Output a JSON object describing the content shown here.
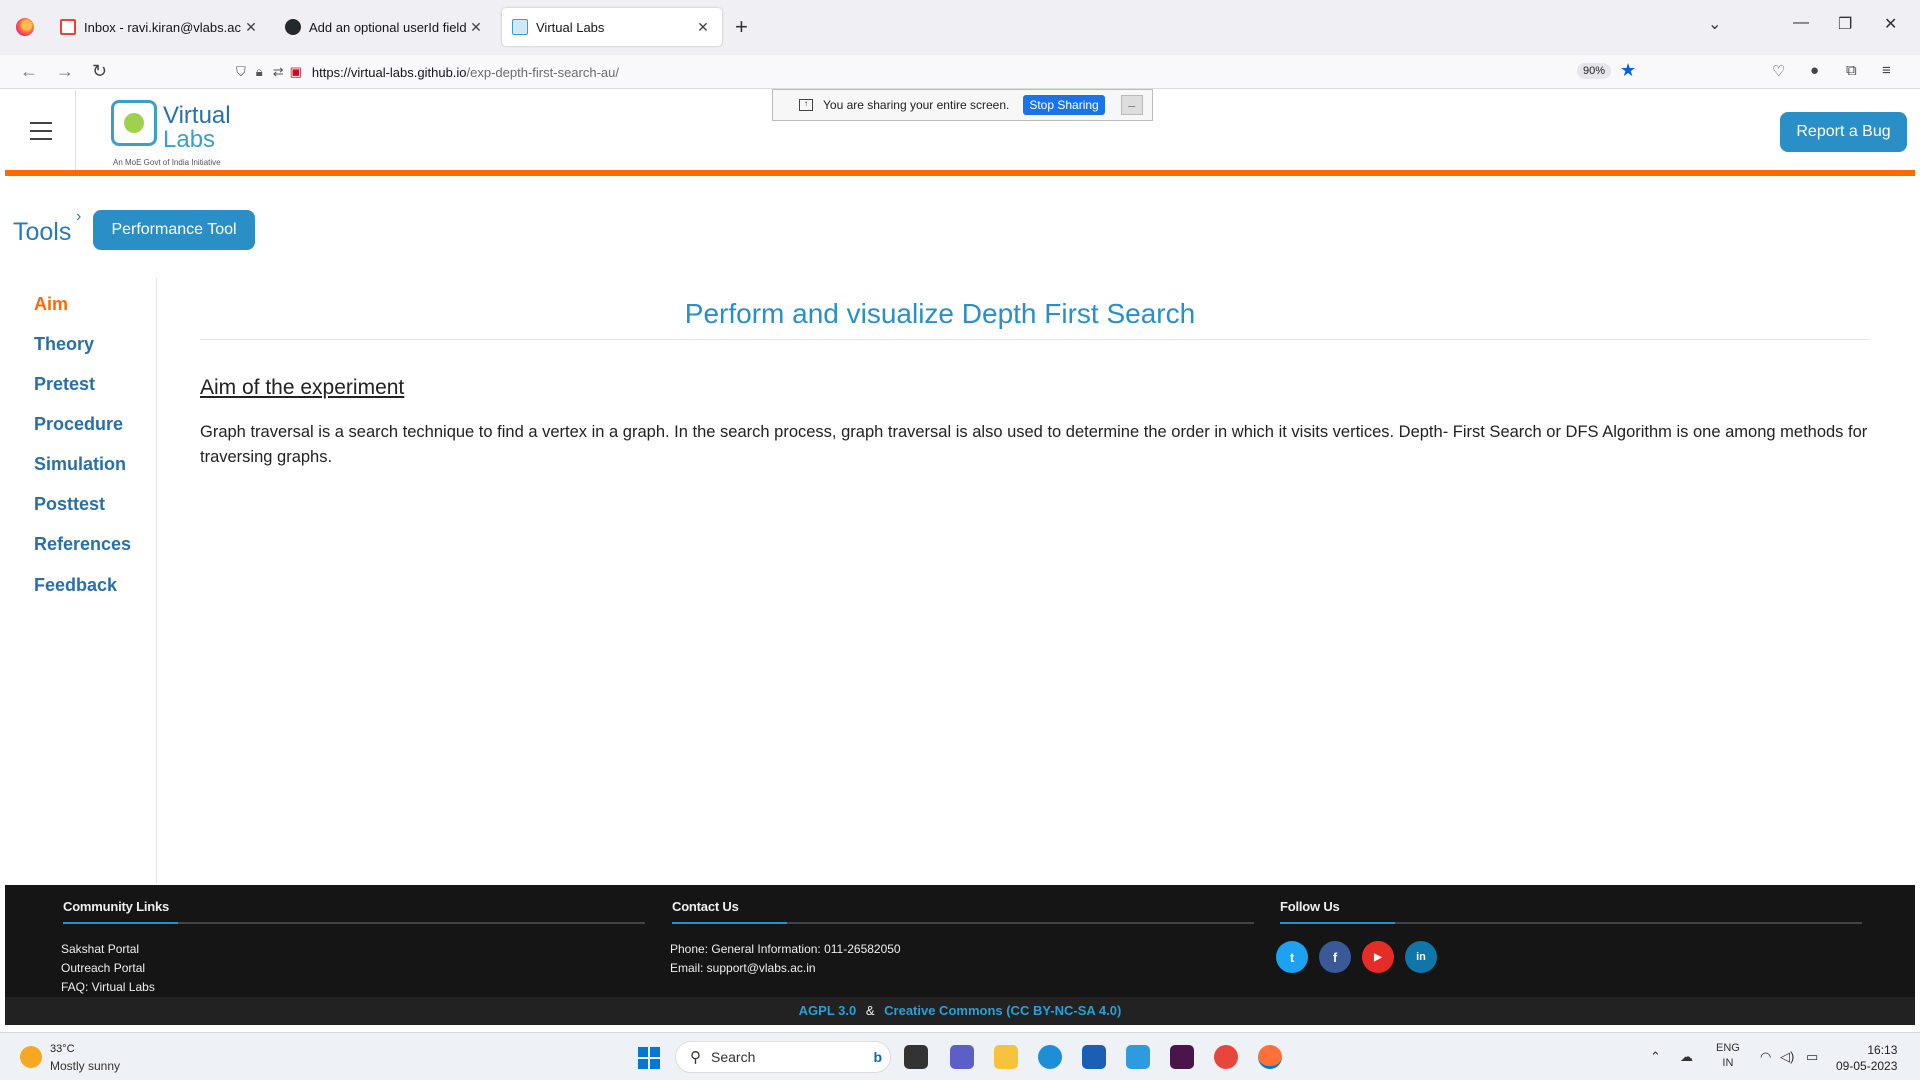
{
  "browser": {
    "tabs": [
      {
        "title": "Inbox - ravi.kiran@vlabs.ac.in -",
        "active": false
      },
      {
        "title": "Add an optional userId field · Is",
        "active": false
      },
      {
        "title": "Virtual Labs",
        "active": true
      }
    ],
    "url_host": "https://virtual-labs.github.io",
    "url_path": "/exp-depth-first-search-au/",
    "zoom": "90%"
  },
  "share_bar": {
    "message": "You are sharing your entire screen.",
    "stop_label": "Stop Sharing",
    "minimize_label": "_"
  },
  "header": {
    "logo_line1": "Virtual",
    "logo_line2": "Labs",
    "logo_tagline": "An MoE Govt of India Initiative",
    "report_bug": "Report a Bug"
  },
  "breadcrumb": {
    "root": "Tools",
    "separator": "›",
    "current": "Performance Tool"
  },
  "sidebar": {
    "items": [
      {
        "label": "Aim",
        "active": true
      },
      {
        "label": "Theory",
        "active": false
      },
      {
        "label": "Pretest",
        "active": false
      },
      {
        "label": "Procedure",
        "active": false
      },
      {
        "label": "Simulation",
        "active": false
      },
      {
        "label": "Posttest",
        "active": false
      },
      {
        "label": "References",
        "active": false
      },
      {
        "label": "Feedback",
        "active": false
      }
    ]
  },
  "main": {
    "title": "Perform and visualize Depth First Search",
    "aim_heading": "Aim of the experiment",
    "aim_text": "Graph traversal is a search technique to find a vertex in a graph. In the search process, graph traversal is also used to determine the order in which it visits vertices. Depth- First Search or DFS Algorithm is one among methods for traversing graphs."
  },
  "footer": {
    "community_heading": "Community Links",
    "community_links": [
      "Sakshat Portal",
      "Outreach Portal",
      "FAQ: Virtual Labs"
    ],
    "contact_heading": "Contact Us",
    "contact_phone": "Phone: General Information: 011-26582050",
    "contact_email": "Email: support@vlabs.ac.in",
    "follow_heading": "Follow Us",
    "social": [
      {
        "icon": "twitter-icon",
        "glyph": "t",
        "color": "#1da1f2"
      },
      {
        "icon": "facebook-icon",
        "glyph": "f",
        "color": "#3b5998"
      },
      {
        "icon": "youtube-icon",
        "glyph": "▶",
        "color": "#e52d27"
      },
      {
        "icon": "linkedin-icon",
        "glyph": "in",
        "color": "#0e76a8"
      }
    ],
    "license_1": "AGPL 3.0",
    "license_amp": "&",
    "license_2": "Creative Commons (CC BY-NC-SA 4.0)"
  },
  "taskbar": {
    "temperature": "33°C",
    "weather": "Mostly sunny",
    "search_placeholder": "Search",
    "lang_1": "ENG",
    "lang_2": "IN",
    "time": "16:13",
    "date": "09-05-2023"
  },
  "colors": {
    "accent": "#2a8fc7",
    "orange": "#ff6a00"
  }
}
